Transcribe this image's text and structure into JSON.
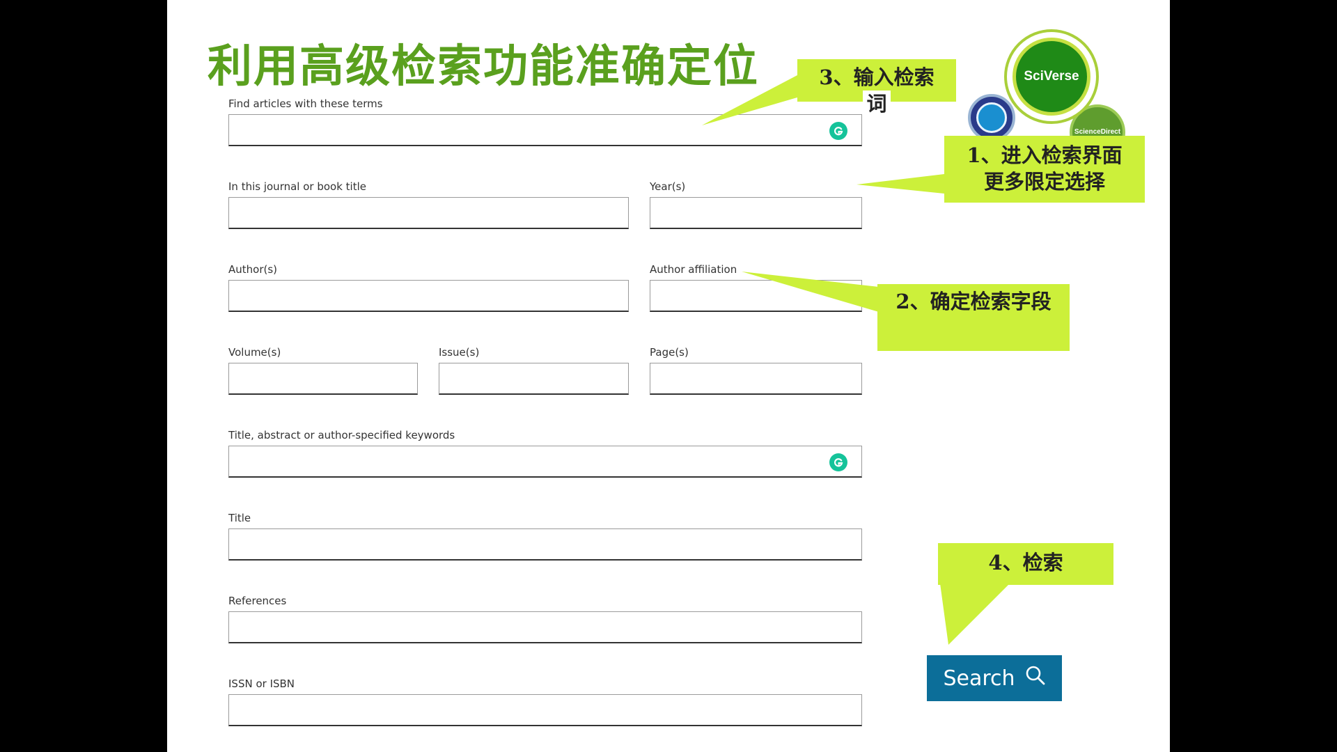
{
  "title": "利用高级检索功能准确定位",
  "logo": {
    "main_text": "SciVerse",
    "sub_text": "ScienceDirect"
  },
  "fields": {
    "terms": "Find articles with these terms",
    "journal": "In this journal or book title",
    "years": "Year(s)",
    "authors": "Author(s)",
    "affiliation": "Author affiliation",
    "volume": "Volume(s)",
    "issue": "Issue(s)",
    "pages": "Page(s)",
    "keywords": "Title, abstract or author-specified keywords",
    "title": "Title",
    "references": "References",
    "issn": "ISSN or ISBN"
  },
  "callouts": {
    "c1_line1": "1、进入检索界面",
    "c1_line2": "更多限定选择",
    "c2": "2、确定检索字段",
    "c3_line1": "3、输入检索",
    "c3_line2": "词",
    "c4": "4、检索"
  },
  "search_button": {
    "label": "Search",
    "icon": "search-icon"
  },
  "colors": {
    "callout": "#ccf03a",
    "title": "#5aa01e",
    "button": "#0c6e99",
    "grammarly": "#15c39a"
  }
}
